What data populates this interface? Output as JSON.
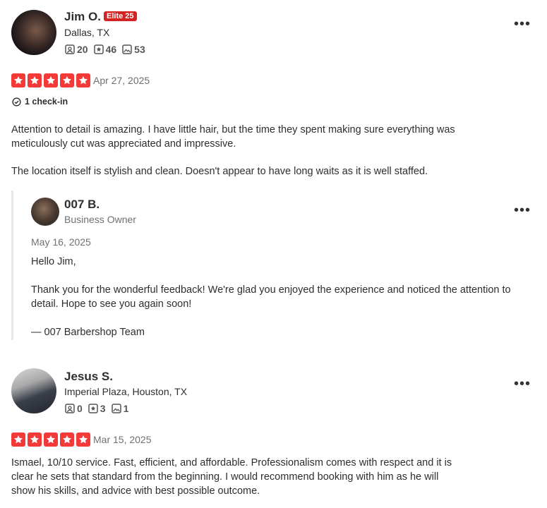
{
  "reviews": [
    {
      "name": "Jim O.",
      "badge": "Elite 25",
      "location": "Dallas, TX",
      "stats": {
        "friends": "20",
        "reviews": "46",
        "photos": "53"
      },
      "rating": 5,
      "date": "Apr 27, 2025",
      "checkin": "1 check-in",
      "body": [
        "Attention to detail is amazing. I have little hair, but the time they spent making sure everything was meticulously cut was appreciated and impressive.",
        "The location itself is stylish and clean. Doesn't appear to have long waits as it is well staffed."
      ],
      "owner_reply": {
        "name": "007 B.",
        "role": "Business Owner",
        "date": "May 16, 2025",
        "lines": [
          "Hello Jim,",
          "Thank you for the wonderful feedback! We're glad you enjoyed the experience and noticed the attention to detail. Hope to see you again soon!",
          "— 007 Barbershop Team"
        ]
      }
    },
    {
      "name": "Jesus S.",
      "location": "Imperial Plaza, Houston, TX",
      "stats": {
        "friends": "0",
        "reviews": "3",
        "photos": "1"
      },
      "rating": 5,
      "date": "Mar 15, 2025",
      "body": [
        "Ismael, 10/10 service. Fast, efficient, and affordable. Professionalism comes with respect and it is clear he sets that standard from the beginning. I would recommend booking with him as he will show his skills, and advice with best possible outcome."
      ]
    }
  ],
  "menu_dots": "•••",
  "colors": {
    "star": "#f43939",
    "badge": "#d32323"
  }
}
